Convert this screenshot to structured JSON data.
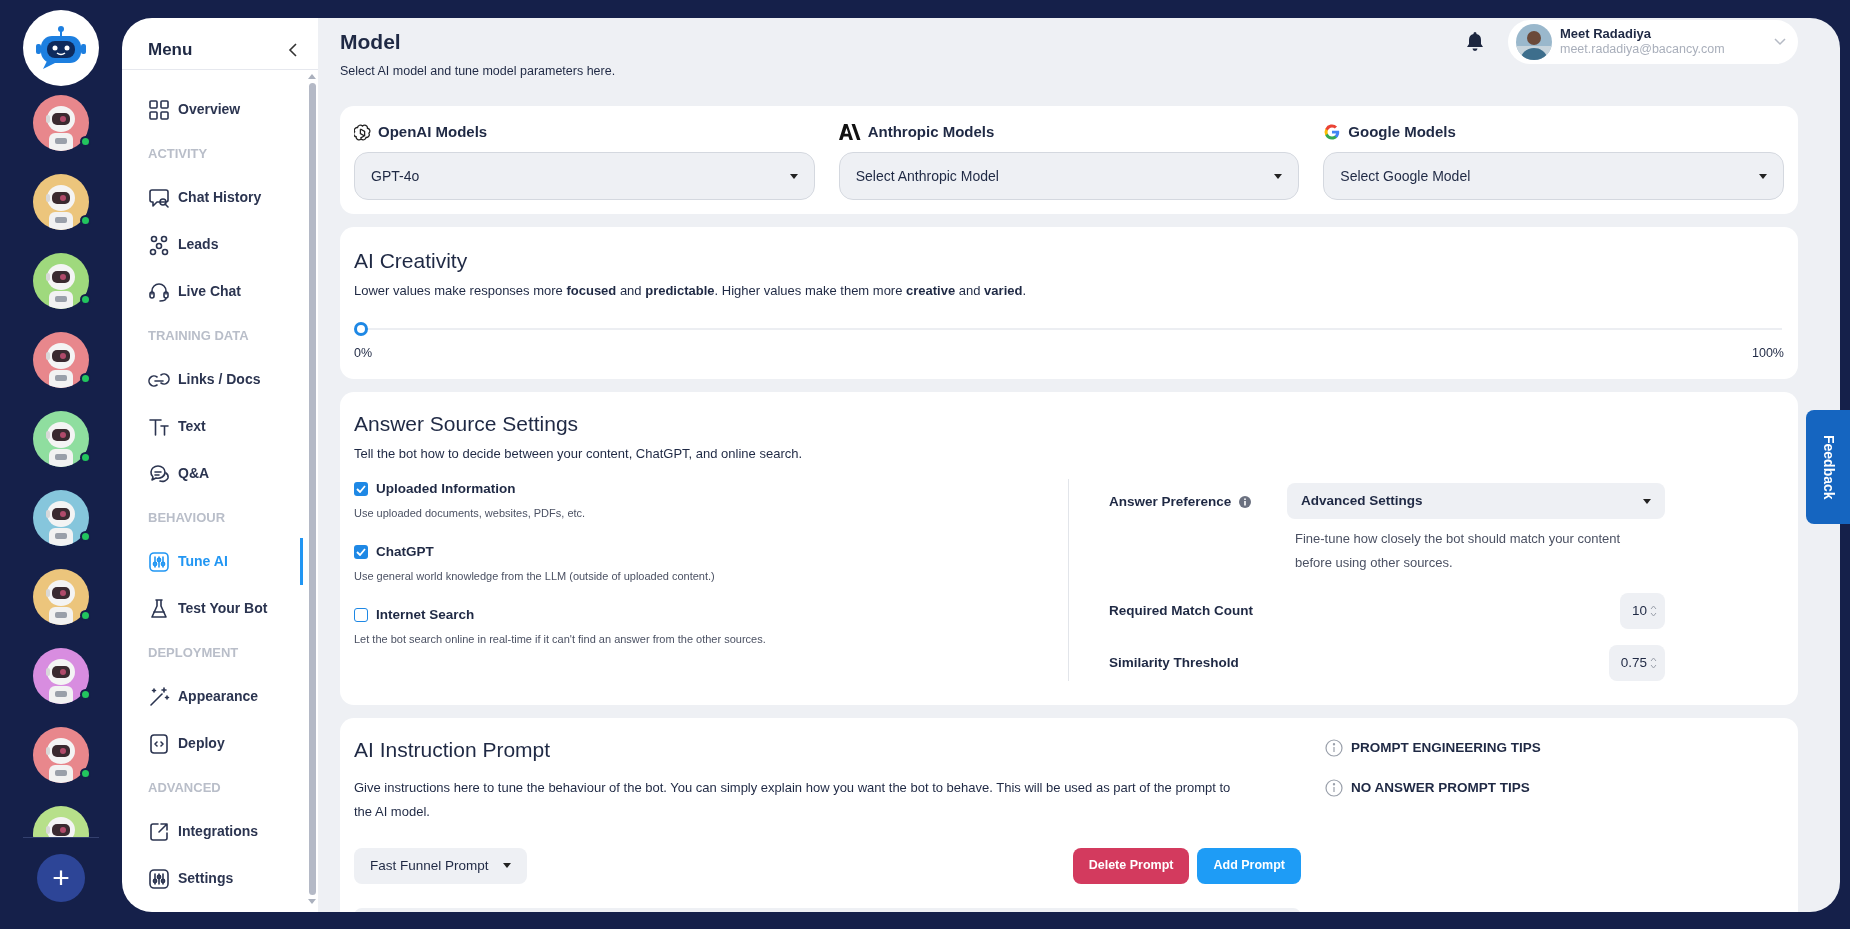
{
  "rail": {
    "bots": [
      {
        "kind": "picture",
        "online": true
      },
      {
        "kind": "picture",
        "online": true
      },
      {
        "kind": "picture",
        "online": true
      },
      {
        "kind": "picture",
        "online": true
      },
      {
        "kind": "picture",
        "online": true
      },
      {
        "kind": "picture",
        "online": true
      },
      {
        "kind": "picture",
        "online": true
      },
      {
        "kind": "picture",
        "online": true
      },
      {
        "kind": "picture",
        "online": true
      },
      {
        "kind": "picture"
      }
    ],
    "add_button": "+"
  },
  "menu": {
    "title": "Menu",
    "sections": [
      {
        "items": [
          {
            "label": "Overview",
            "selected": false
          }
        ]
      },
      {
        "heading": "ACTIVITY",
        "items": [
          {
            "label": "Chat History",
            "selected": false
          },
          {
            "label": "Leads",
            "selected": false
          },
          {
            "label": "Live Chat",
            "selected": false
          }
        ]
      },
      {
        "heading": "TRAINING DATA",
        "items": [
          {
            "label": "Links / Docs",
            "selected": false
          },
          {
            "label": "Text",
            "selected": false
          },
          {
            "label": "Q&A",
            "selected": false
          }
        ]
      },
      {
        "heading": "BEHAVIOUR",
        "items": [
          {
            "label": "Tune AI",
            "selected": true
          },
          {
            "label": "Test Your Bot",
            "selected": false
          }
        ]
      },
      {
        "heading": "DEPLOYMENT",
        "items": [
          {
            "label": "Appearance",
            "selected": false
          },
          {
            "label": "Deploy",
            "selected": false
          }
        ]
      },
      {
        "heading": "ADVANCED",
        "items": [
          {
            "label": "Integrations",
            "selected": false
          },
          {
            "label": "Settings",
            "selected": false
          }
        ]
      }
    ]
  },
  "header": {
    "title": "Model",
    "subtitle": "Select AI model and tune model parameters here.",
    "user": {
      "name": "Meet Radadiya",
      "email": "meet.radadiya@bacancy.com"
    }
  },
  "model_providers": [
    {
      "label": "OpenAI Models",
      "value": "GPT-4o"
    },
    {
      "label": "Anthropic Models",
      "value": "Select Anthropic Model"
    },
    {
      "label": "Google Models",
      "value": "Select Google Model"
    }
  ],
  "creativity": {
    "title": "AI Creativity",
    "description": "Lower values make responses more **focused** and **predictable**. Higher values make them more **creative** and **varied**.",
    "level": 0,
    "min_label": "0%",
    "max_label": "100%"
  },
  "answer_source": {
    "title": "Answer Source Settings",
    "description": "Tell the bot how to decide between your content, ChatGPT, and online search.",
    "sources": [
      {
        "label": "Uploaded Information",
        "help": "Use uploaded documents, websites, PDFs, etc.",
        "checked": true
      },
      {
        "label": "ChatGPT",
        "help": "Use general world knowledge from the LLM (outside of uploaded content.)",
        "checked": true
      },
      {
        "label": "Internet Search",
        "help": "Let the bot search online in real-time if it can't find an answer from the other sources.",
        "checked": false
      }
    ],
    "preference": {
      "label": "Answer Preference",
      "value": "Advanced Settings",
      "help": "Fine-tune how closely the bot should match your content before using other sources."
    },
    "fields": [
      {
        "label": "Required Match Count",
        "value": "10"
      },
      {
        "label": "Similarity Threshold",
        "value": "0.75"
      }
    ]
  },
  "instruction": {
    "title": "AI Instruction Prompt",
    "description": "Give instructions here to tune the behaviour of the bot. You can simply explain how you want the bot to behave. This will be used as part of the prompt to the AI model.",
    "tips": [
      "PROMPT ENGINEERING TIPS",
      "NO ANSWER PROMPT TIPS"
    ],
    "prompt_select": "Fast Funnel Prompt",
    "buttons": [
      {
        "label": "Delete Prompt",
        "kind": "danger"
      },
      {
        "label": "Add Prompt",
        "kind": "primary"
      }
    ]
  },
  "feedback_tab": "Feedback"
}
